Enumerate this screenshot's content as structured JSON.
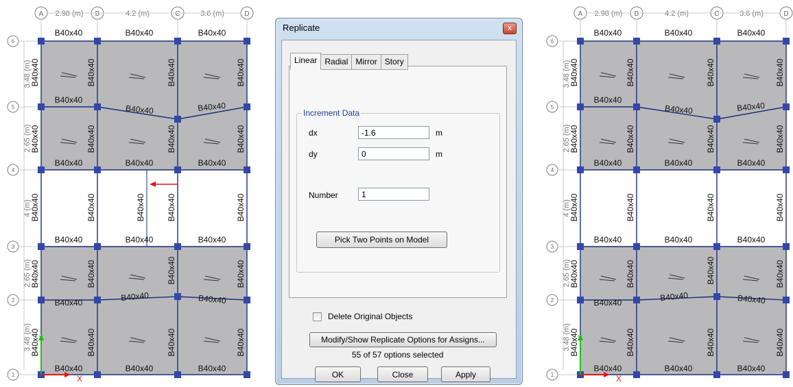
{
  "grid_top_labels": [
    "A",
    "B",
    "C",
    "D"
  ],
  "grid_top_dims": [
    "2.98 (m)",
    "4.2 (m)",
    "3.6 (m)"
  ],
  "grid_left_labels": [
    "6",
    "5",
    "4",
    "3",
    "2",
    "1"
  ],
  "grid_left_labels_dense": [
    "6",
    "5",
    "5",
    "4",
    "3",
    "3",
    "2",
    "1"
  ],
  "grid_left_dims": [
    "3.48 (m)",
    "2.65 (m)",
    "4 (m)",
    "2.65 (m)",
    "3.48 (m)"
  ],
  "beam_label": "B40x40",
  "axis_x": "X",
  "axis_y": "Y",
  "dialog": {
    "title": "Replicate",
    "close": "x",
    "tabs": [
      "Linear",
      "Radial",
      "Mirror",
      "Story"
    ],
    "active_tab": "Linear",
    "group_title": "Increment Data",
    "dx_label": "dx",
    "dx_value": "-1.6",
    "dx_unit": "m",
    "dy_label": "dy",
    "dy_value": "0",
    "dy_unit": "m",
    "number_label": "Number",
    "number_value": "1",
    "pick_button": "Pick Two Points on Model",
    "delete_label": "Delete Original Objects",
    "delete_checked": false,
    "options_button": "Modify/Show Replicate Options for Assigns...",
    "options_status": "55 of 57 options selected",
    "ok": "OK",
    "close_button": "Close",
    "apply": "Apply"
  },
  "colors": {
    "slab": "#b9b9bb",
    "beam": "#1b2f7a",
    "column": "#3447a8",
    "grid_bubble": "#7f7f7f",
    "arrow_red": "#e01818",
    "axis_green": "#18c218",
    "dialog_frame": "#c5d7ec",
    "legend_blue": "#1e3f9a"
  }
}
